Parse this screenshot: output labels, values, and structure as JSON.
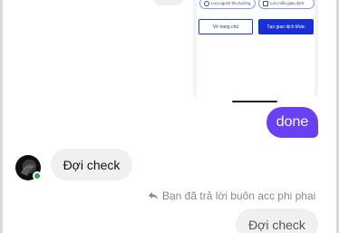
{
  "shared_card": {
    "pill_save_recipient": "Lưu người thụ hưởng",
    "pill_save_transaction": "Lưu mẫu giao dịch",
    "home_button": "Về trang chủ",
    "new_transaction_button": "Tạo giao dịch khác"
  },
  "messages": {
    "outgoing_done": "done",
    "incoming_wait_check": "Đợi check",
    "reply_note": "Bạn đã trả lời buôn acc phi phai",
    "quoted_message": "Đợi check"
  },
  "colors": {
    "outgoing_bubble": "#6b3ff2",
    "incoming_bubble": "#f0f0f0",
    "online_status": "#31a24c",
    "primary_button": "#1a2fd6"
  },
  "icons": {
    "recipient": "person-circle-icon",
    "template": "bookmark-icon",
    "reply": "reply-arrow-icon",
    "online": "online-dot-icon"
  }
}
